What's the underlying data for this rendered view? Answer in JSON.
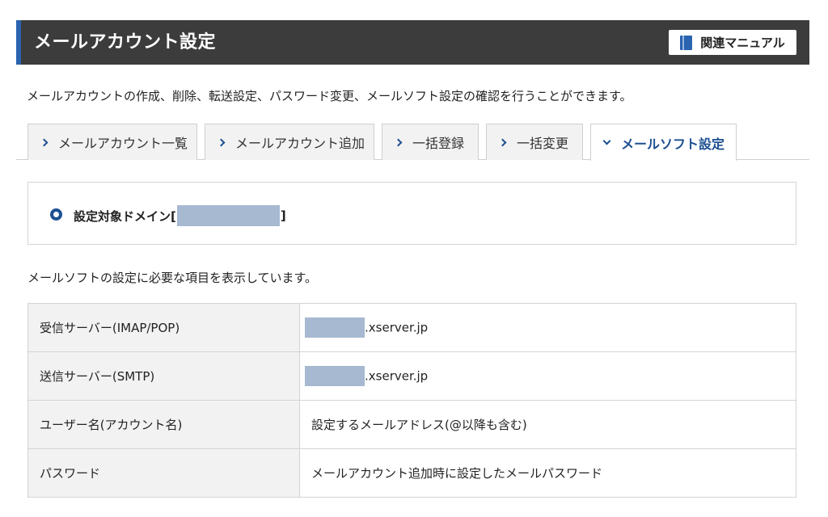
{
  "header": {
    "title": "メールアカウント設定",
    "manual_label": "関連マニュアル"
  },
  "intro": "メールアカウントの作成、削除、転送設定、パスワード変更、メールソフト設定の確認を行うことができます。",
  "tabs": [
    {
      "label": "メールアカウント一覧",
      "active": false
    },
    {
      "label": "メールアカウント追加",
      "active": false
    },
    {
      "label": "一括登録",
      "active": false
    },
    {
      "label": "一括変更",
      "active": false
    },
    {
      "label": "メールソフト設定",
      "active": true
    }
  ],
  "domain": {
    "label_prefix": "設定対象ドメイン[",
    "label_suffix": "]"
  },
  "subintro": "メールソフトの設定に必要な項目を表示しています。",
  "settings_rows": [
    {
      "label": "受信サーバー(IMAP/POP)",
      "value": ".xserver.jp"
    },
    {
      "label": "送信サーバー(SMTP)",
      "value": ".xserver.jp"
    },
    {
      "label": "ユーザー名(アカウント名)",
      "value": "設定するメールアドレス(@以降も含む)"
    },
    {
      "label": "パスワード",
      "value": "メールアカウント追加時に設定したメールパスワード"
    }
  ],
  "colors": {
    "header_bg": "#3c3c3c",
    "accent": "#2a63b0",
    "tab_active_text": "#1d4f91",
    "redaction": "#a7b9d1"
  }
}
